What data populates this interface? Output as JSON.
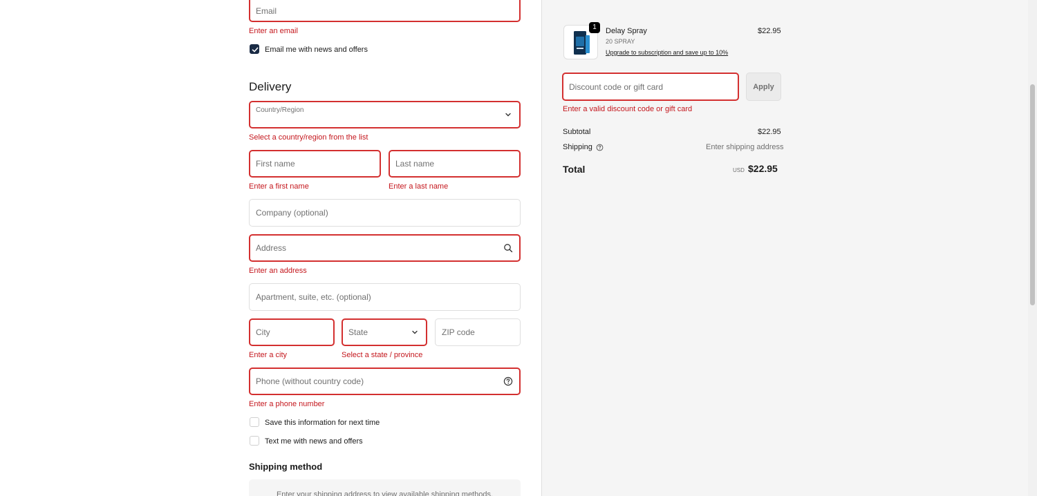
{
  "contact": {
    "email_placeholder": "Email",
    "email_error": "Enter an email",
    "newsletter_label": "Email me with news and offers",
    "newsletter_checked": true
  },
  "delivery": {
    "heading": "Delivery",
    "country_label": "Country/Region",
    "country_error": "Select a country/region from the list",
    "first_name_placeholder": "First name",
    "first_name_error": "Enter a first name",
    "last_name_placeholder": "Last name",
    "last_name_error": "Enter a last name",
    "company_placeholder": "Company (optional)",
    "address_placeholder": "Address",
    "address_error": "Enter an address",
    "apartment_placeholder": "Apartment, suite, etc. (optional)",
    "city_placeholder": "City",
    "city_error": "Enter a city",
    "state_placeholder": "State",
    "state_error": "Select a state / province",
    "zip_placeholder": "ZIP code",
    "phone_placeholder": "Phone (without country code)",
    "phone_error": "Enter a phone number",
    "save_info_label": "Save this information for next time",
    "text_offers_label": "Text me with news and offers"
  },
  "shipping_method": {
    "heading": "Shipping method",
    "message": "Enter your shipping address to view available shipping methods."
  },
  "order": {
    "product": {
      "name": "Delay Spray",
      "variant": "20 SPRAY",
      "upgrade_link": "Upgrade to subscription and save up to 10%",
      "price": "$22.95",
      "quantity": "1"
    },
    "discount_placeholder": "Discount code or gift card",
    "discount_error": "Enter a valid discount code or gift card",
    "apply_label": "Apply",
    "subtotal_label": "Subtotal",
    "subtotal_value": "$22.95",
    "shipping_label": "Shipping",
    "shipping_value": "Enter shipping address",
    "total_label": "Total",
    "total_currency": "USD",
    "total_value": "$22.95"
  },
  "colors": {
    "error": "#d32f2f",
    "checkbox": "#1a2b45",
    "panel_bg": "#f5f5f5"
  }
}
